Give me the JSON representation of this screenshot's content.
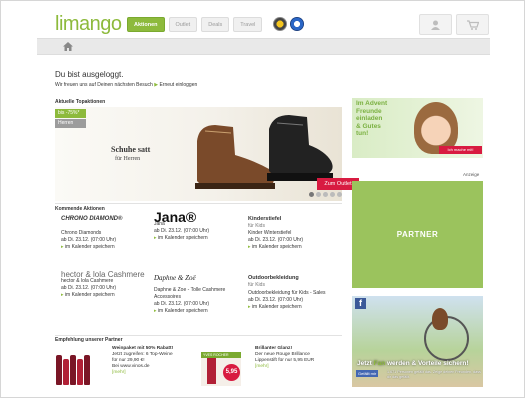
{
  "header": {
    "logo": "limango",
    "nav": [
      "Aktionen",
      "Outlet",
      "Deals",
      "Travel"
    ],
    "active_nav": "Aktionen"
  },
  "main": {
    "title": "Du bist ausgeloggt.",
    "subtitle": "Wir freuen uns auf Deinen nächsten Besuch",
    "relogin": "Erneut einloggen",
    "top_label": "Aktuelle Topaktionen",
    "hero": {
      "discount": "bis -75%*",
      "category": "Herren",
      "headline": "Schuhe satt",
      "subline": "für Herren",
      "cta": "Zum Outlet"
    },
    "upcoming_label": "Kommende Aktionen",
    "upcoming": [
      {
        "logo": "CHRONO DIAMOND®",
        "name": "Chrono Diamonds",
        "date": "ab Di. 23.12. (07:00 Uhr)",
        "cal": "im Kalender speichern"
      },
      {
        "logo": "Jana®",
        "name": "Jana",
        "date": "ab Di. 23.12. (07:00 Uhr)",
        "cal": "im Kalender speichern"
      },
      {
        "logo": "Kinderstiefel",
        "logo_sub": "für Kids",
        "name": "Kinder Winterstiefel",
        "date": "ab Di. 23.12. (07:00 Uhr)",
        "cal": "im Kalender speichern"
      },
      {
        "logo": "hector & lola Cashmere",
        "name": "hector & lola Cashmere",
        "date": "ab Di. 23.12. (07:00 Uhr)",
        "cal": "im Kalender speichern"
      },
      {
        "logo": "Daphne & Zoë",
        "name": "Daphne & Zoe - Tolle Cashmere Accessoires",
        "date": "ab Di. 23.12. (07:00 Uhr)",
        "cal": "im Kalender speichern"
      },
      {
        "logo": "Outdoorbekleidung",
        "logo_sub": "für Kids",
        "name": "Outdoorbekleidung für Kids - Sales",
        "date": "ab Di. 23.12. (07:00 Uhr)",
        "cal": "im Kalender speichern"
      }
    ],
    "partner_label": "Empfehlung unserer Partner",
    "promos": [
      {
        "title": "Weinpaket mit 50% Rabatt!",
        "lines": [
          "Jetzt zugreifen: 6 Top-Weine",
          "für nur 29,90 €!",
          "Bei www.vinos.de"
        ],
        "more": "[mehr]"
      },
      {
        "title": "Brillanter Glanz!",
        "lines": [
          "Der neue Rouge Brillance",
          "Lippenstift für nur 5,95 EUR"
        ],
        "more": "[mehr]",
        "stamp": "YVES ROCHER",
        "price": "5,95"
      }
    ]
  },
  "sidebar": {
    "ad_text": [
      "Im Advent",
      "Freunde",
      "einladen",
      "& Gutes",
      "tun!"
    ],
    "ad_cta": "Ich mache mit!",
    "anzeige": "Anzeige",
    "partner": "PARTNER",
    "fb": {
      "line_a": "Jetzt ",
      "fan": "Fan",
      "line_b": " werden & Vorteile sichern!",
      "like": "Gefällt mir",
      "info": "1.671 Personen gefällt das. Zeige deinen Freunden, dass dir das gefällt."
    }
  },
  "colors": {
    "accent": "#8dba3c",
    "cta": "#d81b41"
  }
}
